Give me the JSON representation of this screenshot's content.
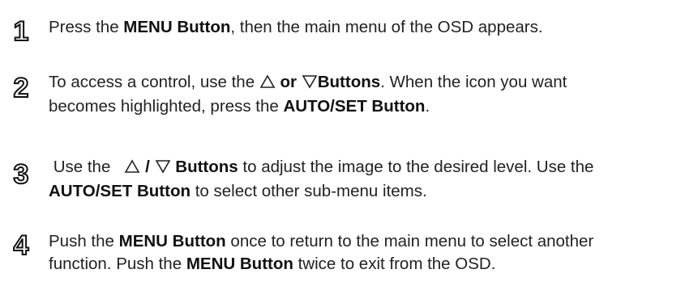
{
  "steps": [
    {
      "number": "1",
      "parts": [
        "Press the ",
        "MENU Button",
        ", then the main menu of the OSD appears."
      ]
    },
    {
      "number": "2",
      "line1": [
        "To access a control, use the ",
        "or",
        "Buttons",
        ". When the icon you want"
      ],
      "line2": [
        "becomes highlighted, press the ",
        "AUTO/SET Button",
        "."
      ]
    },
    {
      "number": "3",
      "line1": [
        " Use the ",
        "/",
        "Buttons",
        " to adjust the image to the desired level. Use the"
      ],
      "line2": [
        "AUTO/SET Button",
        " to select other sub-menu items."
      ]
    },
    {
      "number": "4",
      "line1": [
        "Push the ",
        "MENU Button",
        " once to return to the main menu to select another"
      ],
      "line2": [
        "function. Push the ",
        "MENU Button",
        " twice to exit from the OSD."
      ]
    }
  ],
  "icons": {
    "up": "up-triangle-icon",
    "down": "down-triangle-icon"
  },
  "colors": {
    "text": "#222222",
    "number_outline": "#111111"
  }
}
